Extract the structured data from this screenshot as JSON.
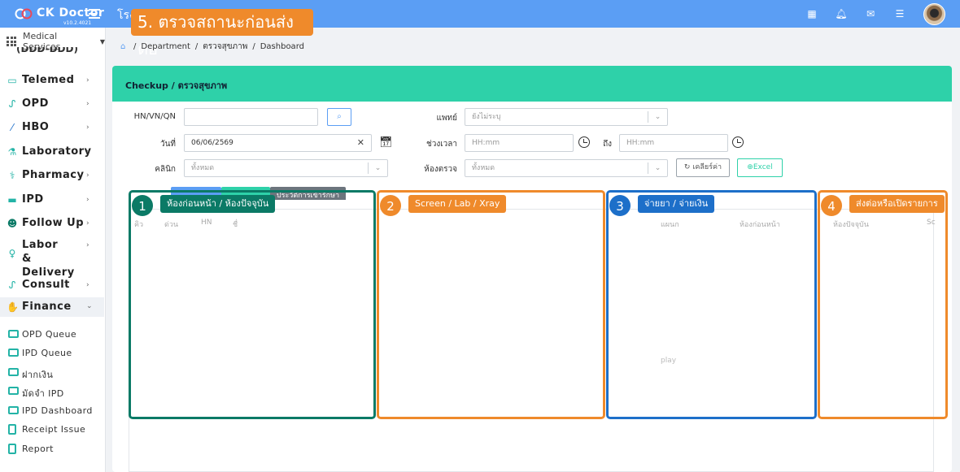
{
  "app": {
    "name": "CK Doctor",
    "version": "v10.2.4021",
    "hospital_partial": "โรง"
  },
  "annotation_banner": "5. ตรวจสถานะก่อนส่งต่อ",
  "top_icons": [
    "apps-grid-icon",
    "bell-icon",
    "mail-icon",
    "tasks-icon"
  ],
  "service_selector": "Medical Services",
  "sidebar": {
    "partial_top": "(DDD-DDD)",
    "items": [
      {
        "label": "Telemed",
        "icon": "video-icon"
      },
      {
        "label": "OPD",
        "icon": "stethoscope-icon"
      },
      {
        "label": "HBO",
        "icon": "syringe-icon"
      },
      {
        "label": "Laboratory",
        "icon": "flask-icon"
      },
      {
        "label": "Pharmacy",
        "icon": "pill-icon"
      },
      {
        "label": "IPD",
        "icon": "bed-icon"
      },
      {
        "label": "Follow Up",
        "icon": "user-check-icon"
      },
      {
        "label": "Labor & Delivery",
        "icon": "mother-icon"
      },
      {
        "label": "Consult",
        "icon": "stethoscope-icon"
      },
      {
        "label": "Finance",
        "icon": "hand-money-icon"
      }
    ],
    "finance_sub": [
      "OPD Queue",
      "IPD Queue",
      "ฝากเงิน",
      "มัดจำ IPD",
      "IPD Dashboard",
      "Receipt Issue",
      "Report"
    ]
  },
  "breadcrumb": [
    "Department",
    "ตรวจสุขภาพ",
    "Dashboard"
  ],
  "card": {
    "title": "Checkup / ตรวจสุขภาพ"
  },
  "form": {
    "hn_label": "HN/VN/QN",
    "hn_value": "",
    "doctor_label": "แพทย์",
    "doctor_value": "ยังไม่ระบุ",
    "date_label": "วันที่",
    "date_value": "06/06/2569",
    "time_label": "ช่วงเวลา",
    "time_from_placeholder": "HH:mm",
    "time_to_label": "ถึง",
    "time_to_placeholder": "HH:mm",
    "clinic_label": "คลินิก",
    "clinic_value": "ทั้งหมด",
    "room_label": "ห้องตรวจ",
    "room_value": "ทั้งหมด",
    "reset_label": "เคลียร์ค่า",
    "excel_label": "Excel"
  },
  "tabs": {
    "history_label": "ประวัติการเข้ารักษา"
  },
  "columns_partial": [
    "คิว",
    "ด่วน",
    "HN",
    "ชื่",
    "แผนก",
    "ห้องก่อนหน้า",
    "ห้องปัจจุบัน",
    "Sc"
  ],
  "faint_text": "play",
  "zones": [
    {
      "num": "1",
      "label": "ห้องก่อนหน้า / ห้องปัจจุบัน"
    },
    {
      "num": "2",
      "label": "Screen / Lab / Xray"
    },
    {
      "num": "3",
      "label": "จ่ายยา / จ่ายเงิน"
    },
    {
      "num": "4",
      "label": "ส่งต่อหรือเปิดรายการ"
    }
  ],
  "colors": {
    "topbar": "#5b9ef4",
    "header": "#2ed1a9",
    "zone_green": "#0b7a66",
    "zone_orange": "#ef8a2b",
    "zone_blue": "#1d6fc9"
  }
}
